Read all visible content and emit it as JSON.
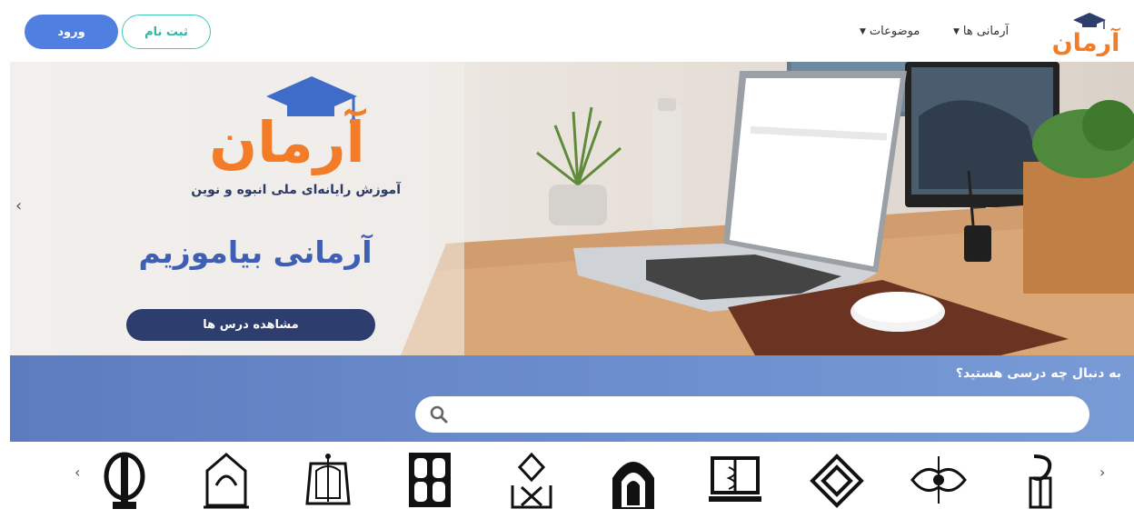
{
  "header": {
    "login_label": "ورود",
    "register_label": "ثبت نام",
    "nav": [
      {
        "label": "آرمانی ها"
      },
      {
        "label": "موضوعات"
      }
    ],
    "logo_icon": "graduation-cap-icon"
  },
  "hero": {
    "brand_name": "آرمان",
    "tagline": "آموزش رایانه‌ای ملی انبوه و نوین",
    "headline": "آرمانی بیاموزیم",
    "cta_label": "مشاهده درس ها",
    "prev_arrow": "‹"
  },
  "search": {
    "question": "به دنبال چه درسی هستید؟",
    "placeholder": ""
  },
  "partners": {
    "prev_arrow": "‹",
    "next_arrow": "›",
    "logos": [
      "university-emblem-icon",
      "university-emblem-icon",
      "university-emblem-icon",
      "university-emblem-icon",
      "university-emblem-icon",
      "university-emblem-icon",
      "university-emblem-icon",
      "university-emblem-icon",
      "university-emblem-icon",
      "university-emblem-icon"
    ]
  },
  "colors": {
    "primary_blue": "#4f7fe0",
    "teal": "#40c9b7",
    "brand_orange": "#f37c28",
    "navy": "#2d3d6e",
    "search_band": "#6b8ccc"
  }
}
